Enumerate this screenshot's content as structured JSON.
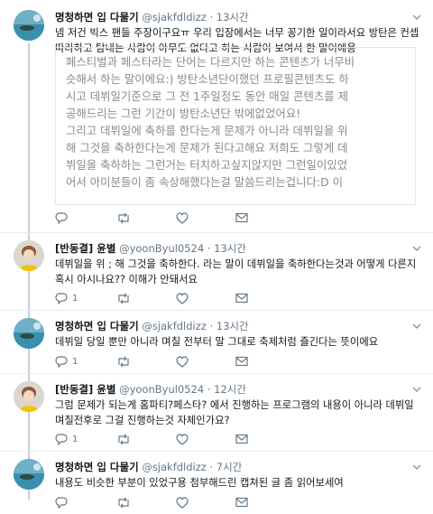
{
  "tweets": [
    {
      "name": "명청하면 입 다물기",
      "handle": "@sjakfdldizz",
      "time": "13시간",
      "text": "넴 저건 빅스 팬들 주장이구요ㅠ 우리 입장에서는 너무 꽁기한 일이라서요 방탄은 컨셉 따라하고 탐내는 사람이 아무도 없다고 하는 사람이 보여서 한 말이에용",
      "quote": [
        "페스티벌과 페스타라는 단어는 다르지만 하는 콘텐츠가 너무비",
        "슷해서 하는 말이에요:) 방탄소년단이했던 프로필콘텐츠도 하",
        "시고 데뷔일기준으로 그 전 1주일정도 동안 매일 콘텐츠를 제",
        "공해드리는 그런 기간이 방탄소년단 밖에없었어요!",
        "그리고 데뷔일에 축하를 한다는게 문제가 아니라 데뷔일을 위",
        "해 그것을 축하한다는게 문제가 된다고해요 저희도 그렇게 데",
        "뷔일을 축하하는 그런거는 터치하고싶지않지만 그런일이있었",
        "어서 아미분들이 좀 속상해했다는걸 말씀드리는겁니다:D 이"
      ]
    },
    {
      "name": "[반동결] 윤별",
      "handle": "@yoonByul0524",
      "time": "13시간",
      "text": "데뷔일을 위 ; 해 그것을 축하한다. 라는 말이 데뷔일을 축하한다는것과 어떻게 다른지 혹시 아시나요?? 이해가 안돼서요"
    },
    {
      "name": "명청하면 입 다물기",
      "handle": "@sjakfdldizz",
      "time": "13시간",
      "text": "데뷔일 당일 뿐만 아니라 며칠 전부터 말 그대로 축제처럼 즐긴다는 뜻이에요"
    },
    {
      "name": "[반동결] 윤별",
      "handle": "@yoonByul0524",
      "time": "12시간",
      "text": "그럼 문제가 되는게 홈파티?페스타? 에서 진행하는 프로그램의 내용이 아니라 데뷔일 며칠전후로 그걸 진행하는것 자체인가요?"
    },
    {
      "name": "명청하면 입 다물기",
      "handle": "@sjakfdldizz",
      "time": "7시간",
      "text": "내용도 비슷한 부분이 있었구용 첨부해드린 캡쳐된 글 좀 읽어보세여"
    }
  ],
  "actions": {
    "t1": [
      "",
      "",
      "",
      ""
    ],
    "t2": [
      "1",
      "",
      "",
      ""
    ],
    "t3": [
      "1",
      "",
      "",
      ""
    ],
    "t4": [
      "1",
      "",
      "",
      ""
    ],
    "t5": [
      "",
      "",
      "",
      ""
    ]
  },
  "colors": {
    "link": "#1b95e0",
    "meta": "#657786",
    "thread": "#c4cfd6"
  }
}
